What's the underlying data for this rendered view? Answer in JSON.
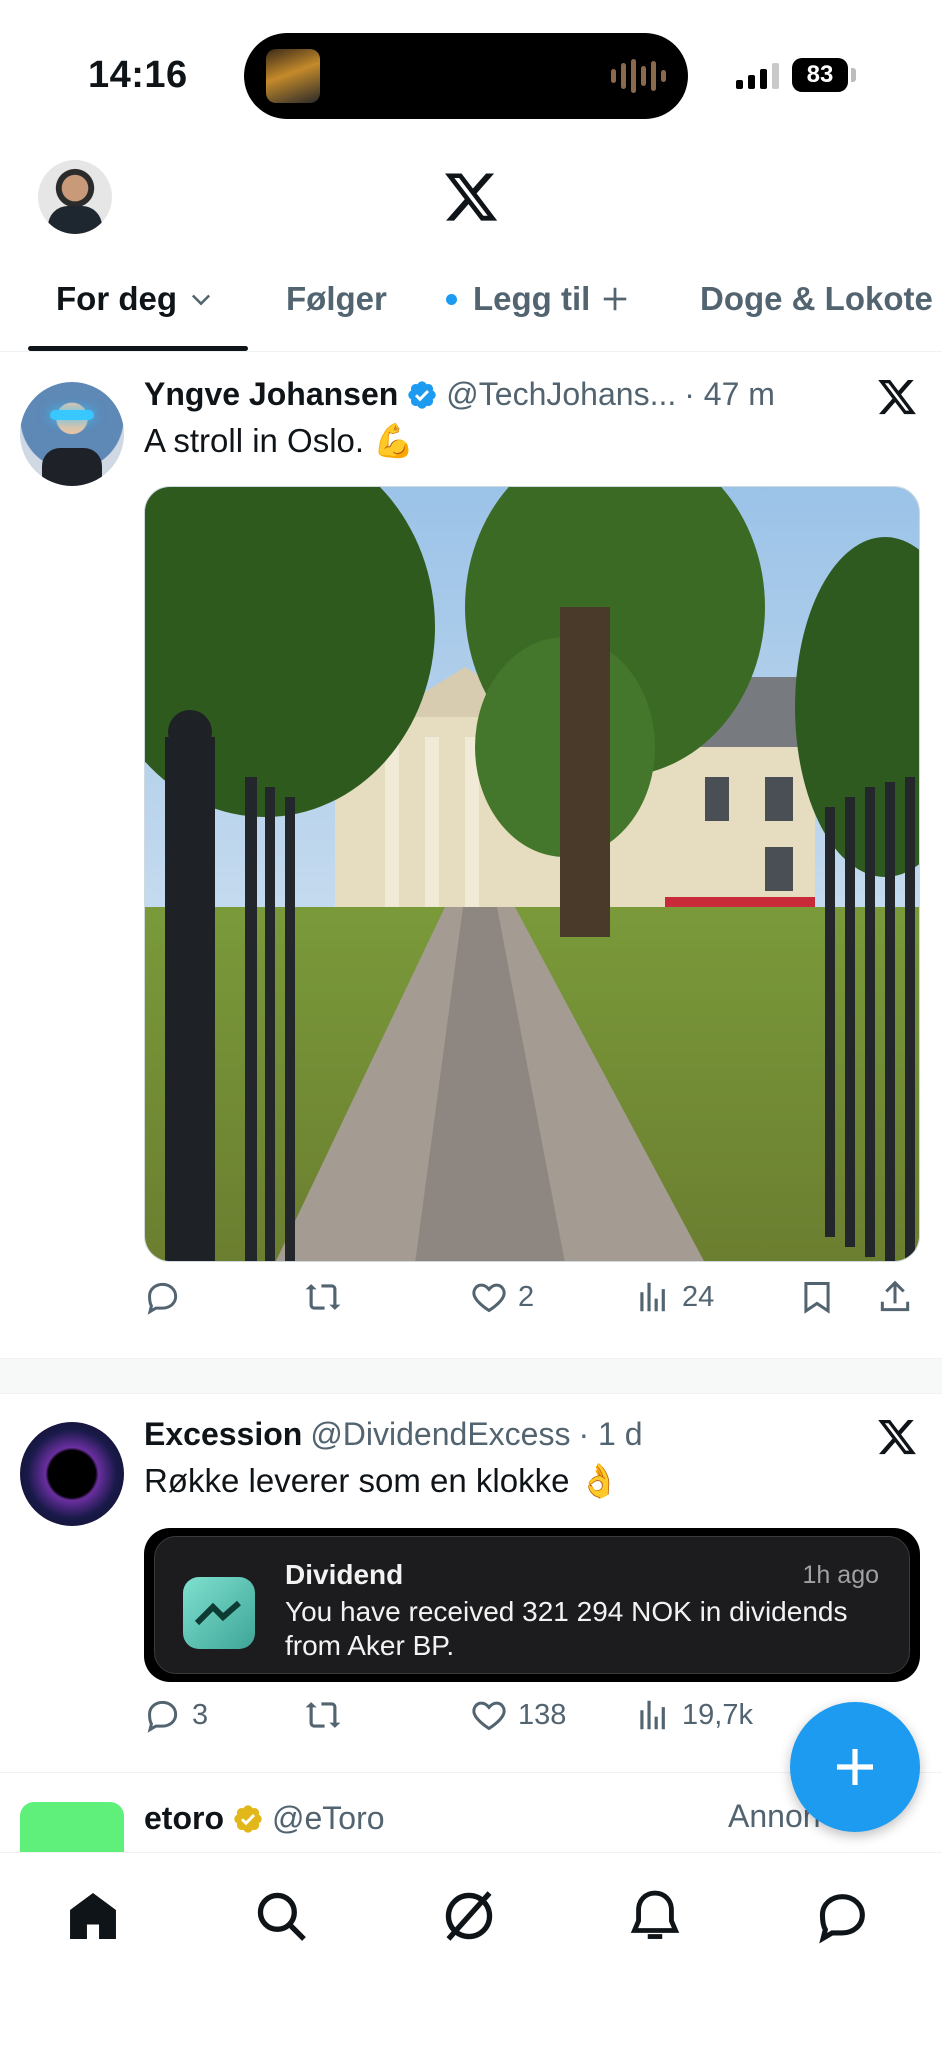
{
  "status_bar": {
    "time": "14:16",
    "battery": "83"
  },
  "tabs": [
    {
      "label": "For deg",
      "active": true
    },
    {
      "label": "Følger"
    },
    {
      "label": "Legg til"
    },
    {
      "label": "Doge & Lokote"
    }
  ],
  "posts": [
    {
      "name": "Yngve Johansen",
      "handle": "@TechJohans...",
      "time": "· 47 m",
      "text": "A stroll in Oslo. 💪",
      "stats": {
        "replies": "",
        "reposts": "",
        "likes": "2",
        "views": "24"
      }
    },
    {
      "name": "Excession",
      "handle": "@DividendExcess",
      "time": "· 1 d",
      "text": "Røkke leverer som en klokke 👌",
      "notification": {
        "title": "Dividend",
        "time": "1h ago",
        "body": "You have received 321 294 NOK in dividends from Aker BP."
      },
      "stats": {
        "replies": "3",
        "reposts": "",
        "likes": "138",
        "views": "19,7k"
      }
    },
    {
      "name": "etoro",
      "handle": "@eToro",
      "label": "Annon"
    }
  ],
  "colors": {
    "accent": "#1d9bf0",
    "text": "#0f1419",
    "secondary": "#536471",
    "gold": "#e2b719"
  }
}
